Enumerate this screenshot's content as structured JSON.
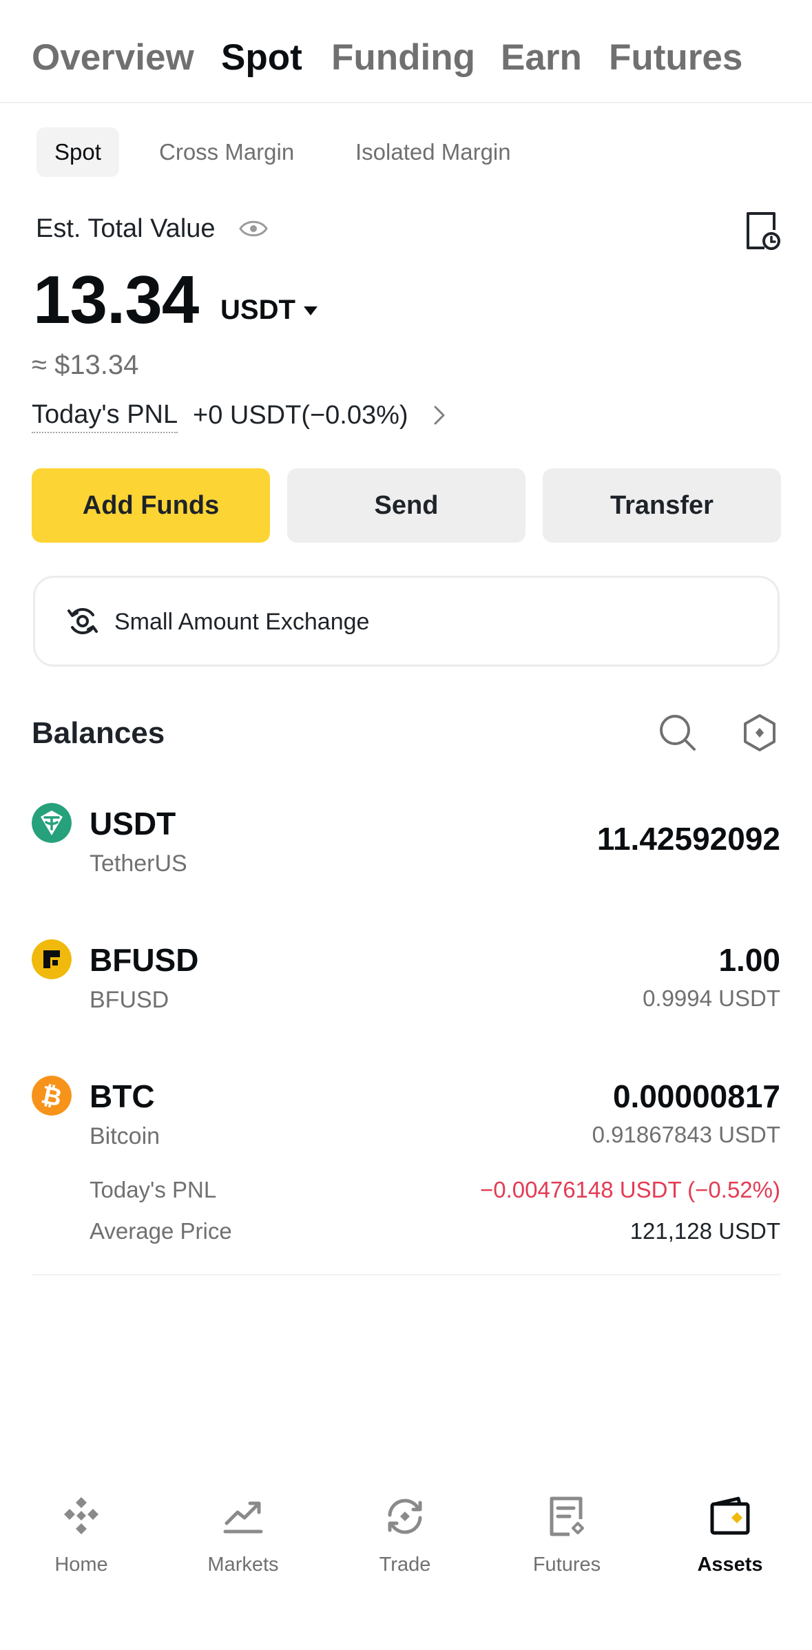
{
  "top_tabs": [
    {
      "label": "Overview"
    },
    {
      "label": "Spot"
    },
    {
      "label": "Funding"
    },
    {
      "label": "Earn"
    },
    {
      "label": "Futures"
    }
  ],
  "sub_tabs": [
    {
      "label": "Spot"
    },
    {
      "label": "Cross Margin"
    },
    {
      "label": "Isolated Margin"
    }
  ],
  "summary": {
    "est_label": "Est. Total Value",
    "total_value": "13.34",
    "unit": "USDT",
    "approx": "≈ $13.34",
    "pnl_label": "Today's PNL",
    "pnl_value": "+0 USDT(−0.03%)"
  },
  "actions": {
    "add_funds": "Add Funds",
    "send": "Send",
    "transfer": "Transfer"
  },
  "exchange": {
    "label": "Small Amount Exchange"
  },
  "balances": {
    "title": "Balances",
    "items": [
      {
        "symbol": "USDT",
        "name": "TetherUS",
        "amount": "11.42592092",
        "icon": "tether-icon",
        "color": "#26a17b"
      },
      {
        "symbol": "BFUSD",
        "name": "BFUSD",
        "amount": "1.00",
        "value": "0.9994 USDT",
        "icon": "bfusd-icon",
        "color": "#f0b90b"
      },
      {
        "symbol": "BTC",
        "name": "Bitcoin",
        "amount": "0.00000817",
        "value": "0.91867843 USDT",
        "icon": "bitcoin-icon",
        "color": "#f7931a",
        "pnl_label": "Today's PNL",
        "pnl_value": "−0.00476148 USDT (−0.52%)",
        "avg_label": "Average Price",
        "avg_value": "121,128 USDT"
      }
    ]
  },
  "nav": {
    "items": [
      {
        "label": "Home",
        "icon": "home-icon"
      },
      {
        "label": "Markets",
        "icon": "markets-icon"
      },
      {
        "label": "Trade",
        "icon": "trade-icon"
      },
      {
        "label": "Futures",
        "icon": "futures-icon"
      },
      {
        "label": "Assets",
        "icon": "assets-icon"
      }
    ]
  },
  "colors": {
    "accent": "#fcd535",
    "negative": "#e33b54",
    "muted": "#707070"
  }
}
